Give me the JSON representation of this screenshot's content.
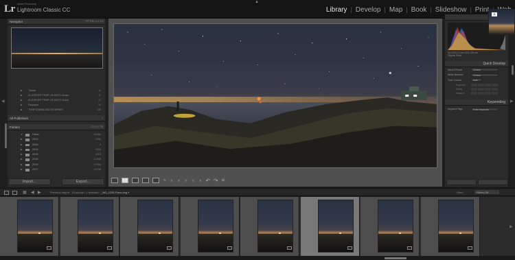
{
  "app": {
    "logo": "Lr",
    "brand_small": "Adobe Photoshop",
    "brand": "Lightroom Classic CC"
  },
  "modules": [
    "Library",
    "Develop",
    "Map",
    "Book",
    "Slideshow",
    "Print",
    "Web"
  ],
  "active_module": "Library",
  "left_panel": {
    "navigator": {
      "title": "Navigator",
      "options": "FIT  FILL  1:1  1:3"
    },
    "catalog_items": [
      {
        "label": "Tickets",
        "count": "11"
      },
      {
        "label": "01-EXPORT TEMP LR-MOTO Model",
        "count": "11"
      },
      {
        "label": "01-EXPORT TEMP LR-MOTO Scene",
        "count": "12"
      },
      {
        "label": "Pallpaper",
        "count": "14"
      },
      {
        "label": "TEMP DOWNLOAD INTERNET",
        "count": "135"
      }
    ],
    "collections_header": "All Publishers",
    "folders_header": {
      "title": "Folders",
      "count": "2.2 / 4.7 TB"
    },
    "folders": [
      {
        "label": "Fotos",
        "count": "64566"
      },
      {
        "label": "2004",
        "count": "1396"
      },
      {
        "label": "2006",
        "count": "8"
      },
      {
        "label": "2014",
        "count": "4008"
      },
      {
        "label": "2015",
        "count": "4115"
      },
      {
        "label": "2016",
        "count": "10085"
      },
      {
        "label": "2016",
        "count": "17666"
      },
      {
        "label": "2017",
        "count": "23756"
      }
    ],
    "import_label": "Import...",
    "export_label": "Export..."
  },
  "right_panel": {
    "histogram_title": "Histogram",
    "hist_info": "ISO 6400     24 mm     f/2.8     1/25 sec",
    "original_photo": "Original Photo",
    "quick_develop_title": "Quick Develop",
    "saved_preset": {
      "label": "Saved Preset",
      "value": "Custom"
    },
    "white_balance": {
      "label": "White Balance",
      "value": "Custom"
    },
    "tone_control": {
      "label": "Tone Control",
      "value": "Auto"
    },
    "tone_rows": [
      "Exposure",
      "Clarity",
      "Vibrance"
    ],
    "keywording_title": "Keywording",
    "keyword_tags": {
      "label": "Keyword Tags",
      "value": "Enter Keywords"
    }
  },
  "filmstrip": {
    "source_prefix": "Previous Import",
    "source_info": "15 photos / 1 selected /",
    "source_file": "_MG_1292-Pano.dng",
    "filter_label": "Filter:",
    "filter_value": "Filters Off",
    "thumb_count": 8,
    "selected_index": 5
  },
  "colors": {
    "accent": "#e6e6e6",
    "panel_bg": "#2a2a2a",
    "center_bg": "#505050",
    "filmstrip_selected": "#787878"
  }
}
